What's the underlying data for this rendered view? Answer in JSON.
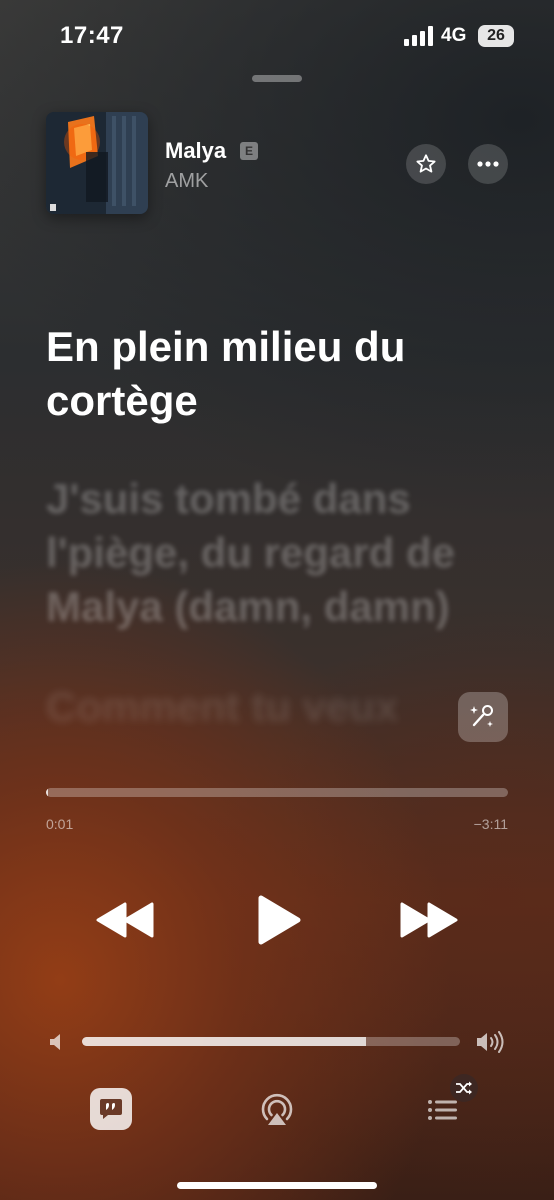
{
  "status_bar": {
    "time": "17:47",
    "network": "4G",
    "battery": "26"
  },
  "now_playing": {
    "title": "Malya",
    "explicit_badge": "E",
    "artist": "AMK"
  },
  "lyrics": {
    "active": "En plein milieu du cortège",
    "next": "J'suis tombé dans l'piège, du regard de Malya (damn, damn)",
    "upcoming": "Comment tu veux"
  },
  "playback": {
    "elapsed": "0:01",
    "remaining": "−3:11",
    "progress_fraction": 0.005,
    "volume_fraction": 0.75
  },
  "icons": {
    "favorite": "star-icon",
    "more": "ellipsis-icon",
    "sing": "microphone-sparkle-icon",
    "rewind": "backward-icon",
    "play": "play-icon",
    "forward": "forward-icon",
    "volume_low": "speaker-icon",
    "volume_high": "speaker-wave-icon",
    "lyrics": "quote-bubble-icon",
    "airplay": "airplay-icon",
    "queue": "list-icon",
    "shuffle": "shuffle-icon"
  },
  "colors": {
    "accent": "#ffffff",
    "background_warm": "#963e16"
  }
}
